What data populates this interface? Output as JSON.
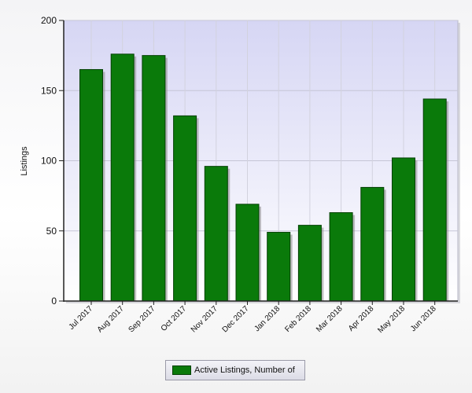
{
  "chart_data": {
    "type": "bar",
    "title": "",
    "xlabel": "",
    "ylabel": "Listings",
    "ylim": [
      0,
      200
    ],
    "yticks": [
      0,
      50,
      100,
      150,
      200
    ],
    "grid": true,
    "legend_position": "bottom-center",
    "categories": [
      "Jul 2017",
      "Aug 2017",
      "Sep 2017",
      "Oct 2017",
      "Nov 2017",
      "Dec 2017",
      "Jan 2018",
      "Feb 2018",
      "Mar 2018",
      "Apr 2018",
      "May 2018",
      "Jun 2018"
    ],
    "series": [
      {
        "name": "Active Listings, Number of",
        "color": "#0a7a0a",
        "values": [
          165,
          176,
          175,
          132,
          96,
          69,
          49,
          54,
          63,
          81,
          102,
          144
        ]
      }
    ]
  },
  "colors": {
    "bar": "#0a7a0a",
    "bar_edge": "#044004",
    "plot_bg_top": "#d8d8f6",
    "plot_bg_bottom": "#ffffff",
    "grid": "#c8c8d8"
  }
}
